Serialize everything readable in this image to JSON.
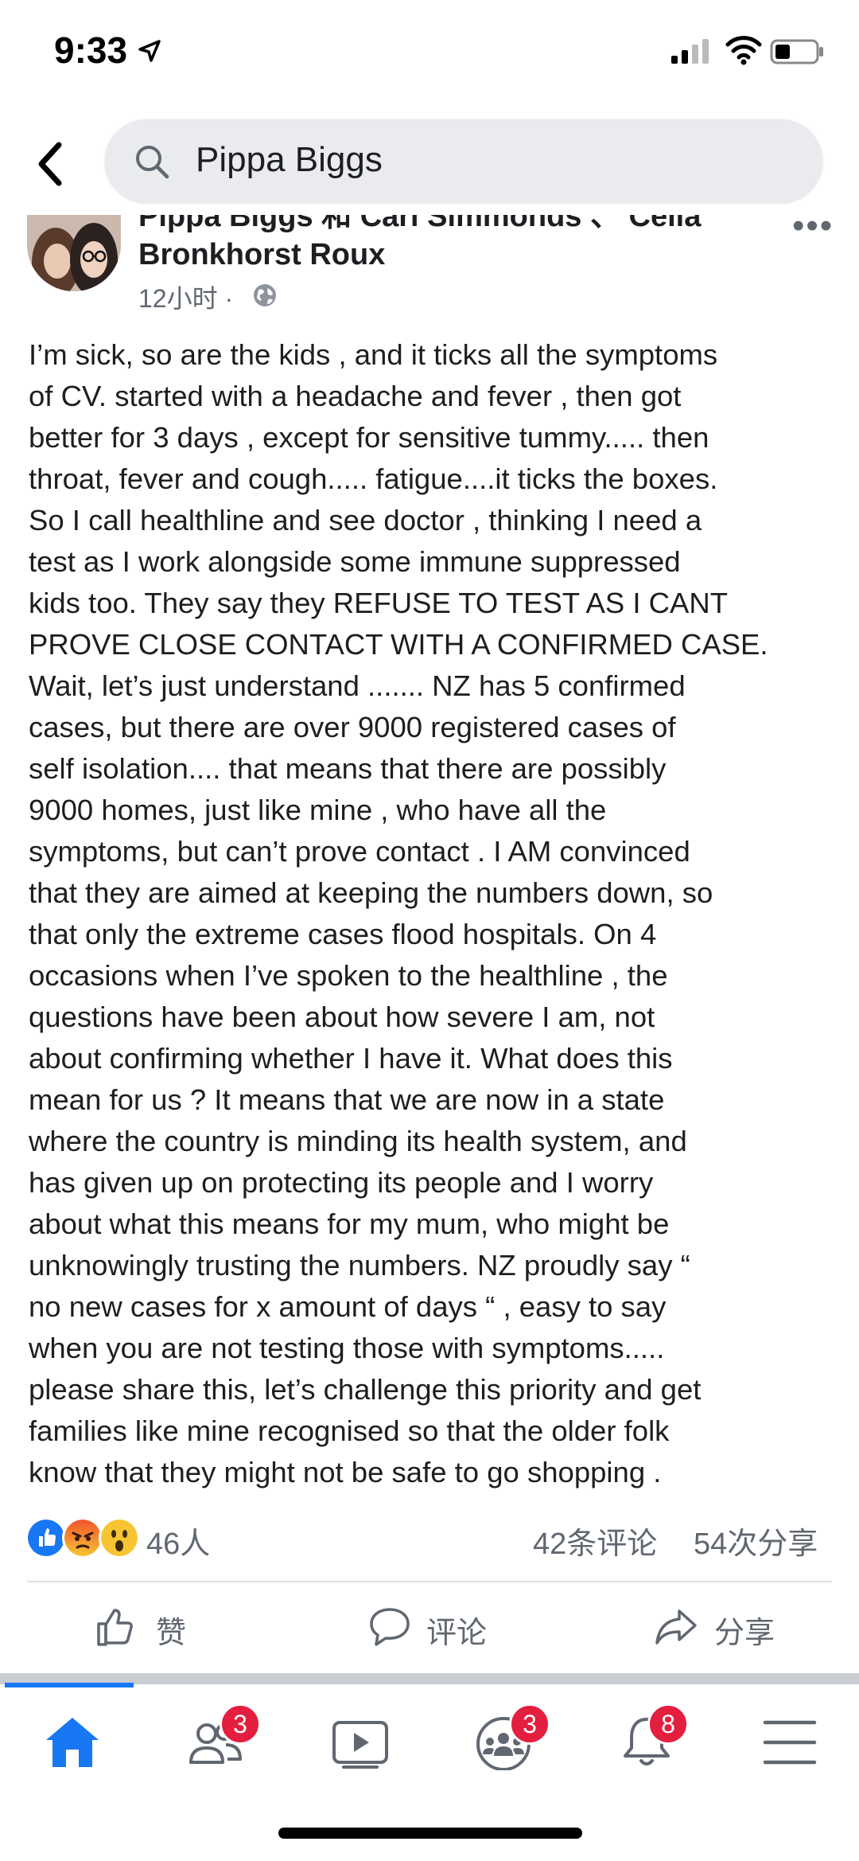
{
  "status_bar": {
    "time": "9:33"
  },
  "search": {
    "query": "Pippa Biggs"
  },
  "post": {
    "authors_line": "Pippa Biggs 和 Carl Simmonds 、 Celia Bronkhorst Roux",
    "timestamp": "12小时 ·",
    "body": "I’m sick, so are the kids , and it ticks all the symptoms\nof CV. started with a headache and fever , then got\nbetter for 3 days , except for sensitive tummy..... then\nthroat, fever and cough..... fatigue....it ticks the boxes.\nSo I call healthline and see doctor , thinking I need a\ntest as I work alongside some immune suppressed\nkids too. They say they REFUSE TO TEST AS I CANT\nPROVE CLOSE CONTACT WITH A CONFIRMED CASE.\nWait, let’s just understand ....... NZ has 5 confirmed\ncases, but there are over 9000 registered cases of\nself isolation.... that means that there are possibly\n9000 homes, just like mine , who have all the\nsymptoms, but can’t prove contact . I AM convinced\nthat they are aimed at keeping the numbers down, so\nthat only the extreme cases flood hospitals. On 4\noccasions when I’ve spoken to the healthline , the\nquestions have been about how severe I am, not\nabout confirming whether I have it. What does this\nmean for us ? It means that we are now in a state\nwhere the country is minding its health system, and\nhas given up on protecting its people and I worry\nabout what this means for my mum, who might be\nunknowingly trusting the numbers. NZ proudly say “\nno new cases for x amount of days “ , easy to say\nwhen you are not testing those with symptoms.....\nplease share this, let’s challenge this priority and get\nfamilies like mine recognised so that the older folk\nknow that they might not be safe to go shopping .",
    "reaction_count": "46人",
    "comment_count": "42条评论",
    "share_count": "54次分享"
  },
  "actions": {
    "like": "赞",
    "comment": "评论",
    "share": "分享"
  },
  "tabbar": {
    "friends_badge": "3",
    "groups_badge": "3",
    "notifications_badge": "8"
  },
  "colors": {
    "brand_blue": "#1877f2",
    "badge_red": "#e41e3f",
    "text_gray": "#606770"
  }
}
